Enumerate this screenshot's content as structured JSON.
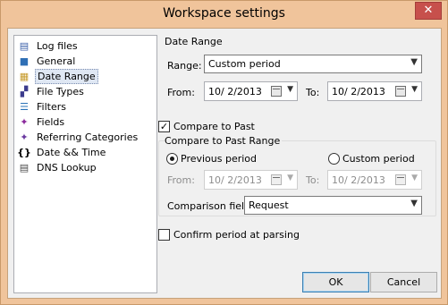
{
  "window": {
    "title": "Workspace settings",
    "close_glyph": "✕"
  },
  "tree": {
    "items": [
      {
        "label": "Log files",
        "icon": "log-files-icon",
        "glyph": "▤",
        "color": "#3a5fa8"
      },
      {
        "label": "General",
        "icon": "general-icon",
        "glyph": "■",
        "color": "#2f6fb5"
      },
      {
        "label": "Date Range",
        "icon": "calendar-grid-icon",
        "glyph": "▦",
        "color": "#c69a2a",
        "selected": true
      },
      {
        "label": "File Types",
        "icon": "file-types-icon",
        "glyph": "▞",
        "color": "#3b3b8c"
      },
      {
        "label": "Filters",
        "icon": "filters-icon",
        "glyph": "☰",
        "color": "#2a73b8"
      },
      {
        "label": "Fields",
        "icon": "fields-icon",
        "glyph": "✦",
        "color": "#8b2a9c"
      },
      {
        "label": "Referring Categories",
        "icon": "referring-categories-icon",
        "glyph": "✦",
        "color": "#6b3aa0"
      },
      {
        "label": "Date && Time",
        "icon": "braces-icon",
        "glyph": "{}",
        "color": "#000000"
      },
      {
        "label": "DNS Lookup",
        "icon": "dns-lookup-icon",
        "glyph": "▤",
        "color": "#4a4a4a"
      }
    ]
  },
  "date_range": {
    "group_label": "Date Range",
    "range_label": "Range:",
    "range_value": "Custom period",
    "from_label": "From:",
    "from_value": "10/  2/2013",
    "to_label": "To:",
    "to_value": "10/  2/2013"
  },
  "compare": {
    "checkbox_label": "Compare to Past",
    "checked": true,
    "group_label": "Compare to Past Range",
    "previous_label": "Previous period",
    "custom_label": "Custom period",
    "from_label": "From:",
    "from_value": "10/  2/2013",
    "to_label": "To:",
    "to_value": "10/  2/2013",
    "field_label": "Comparison field:",
    "field_value": "Request"
  },
  "confirm": {
    "label": "Confirm period at parsing",
    "checked": false
  },
  "buttons": {
    "ok": "OK",
    "cancel": "Cancel"
  },
  "colors": {
    "frame": "#f0c49b",
    "close": "#c7504c",
    "selection": "#dfe7f3"
  }
}
